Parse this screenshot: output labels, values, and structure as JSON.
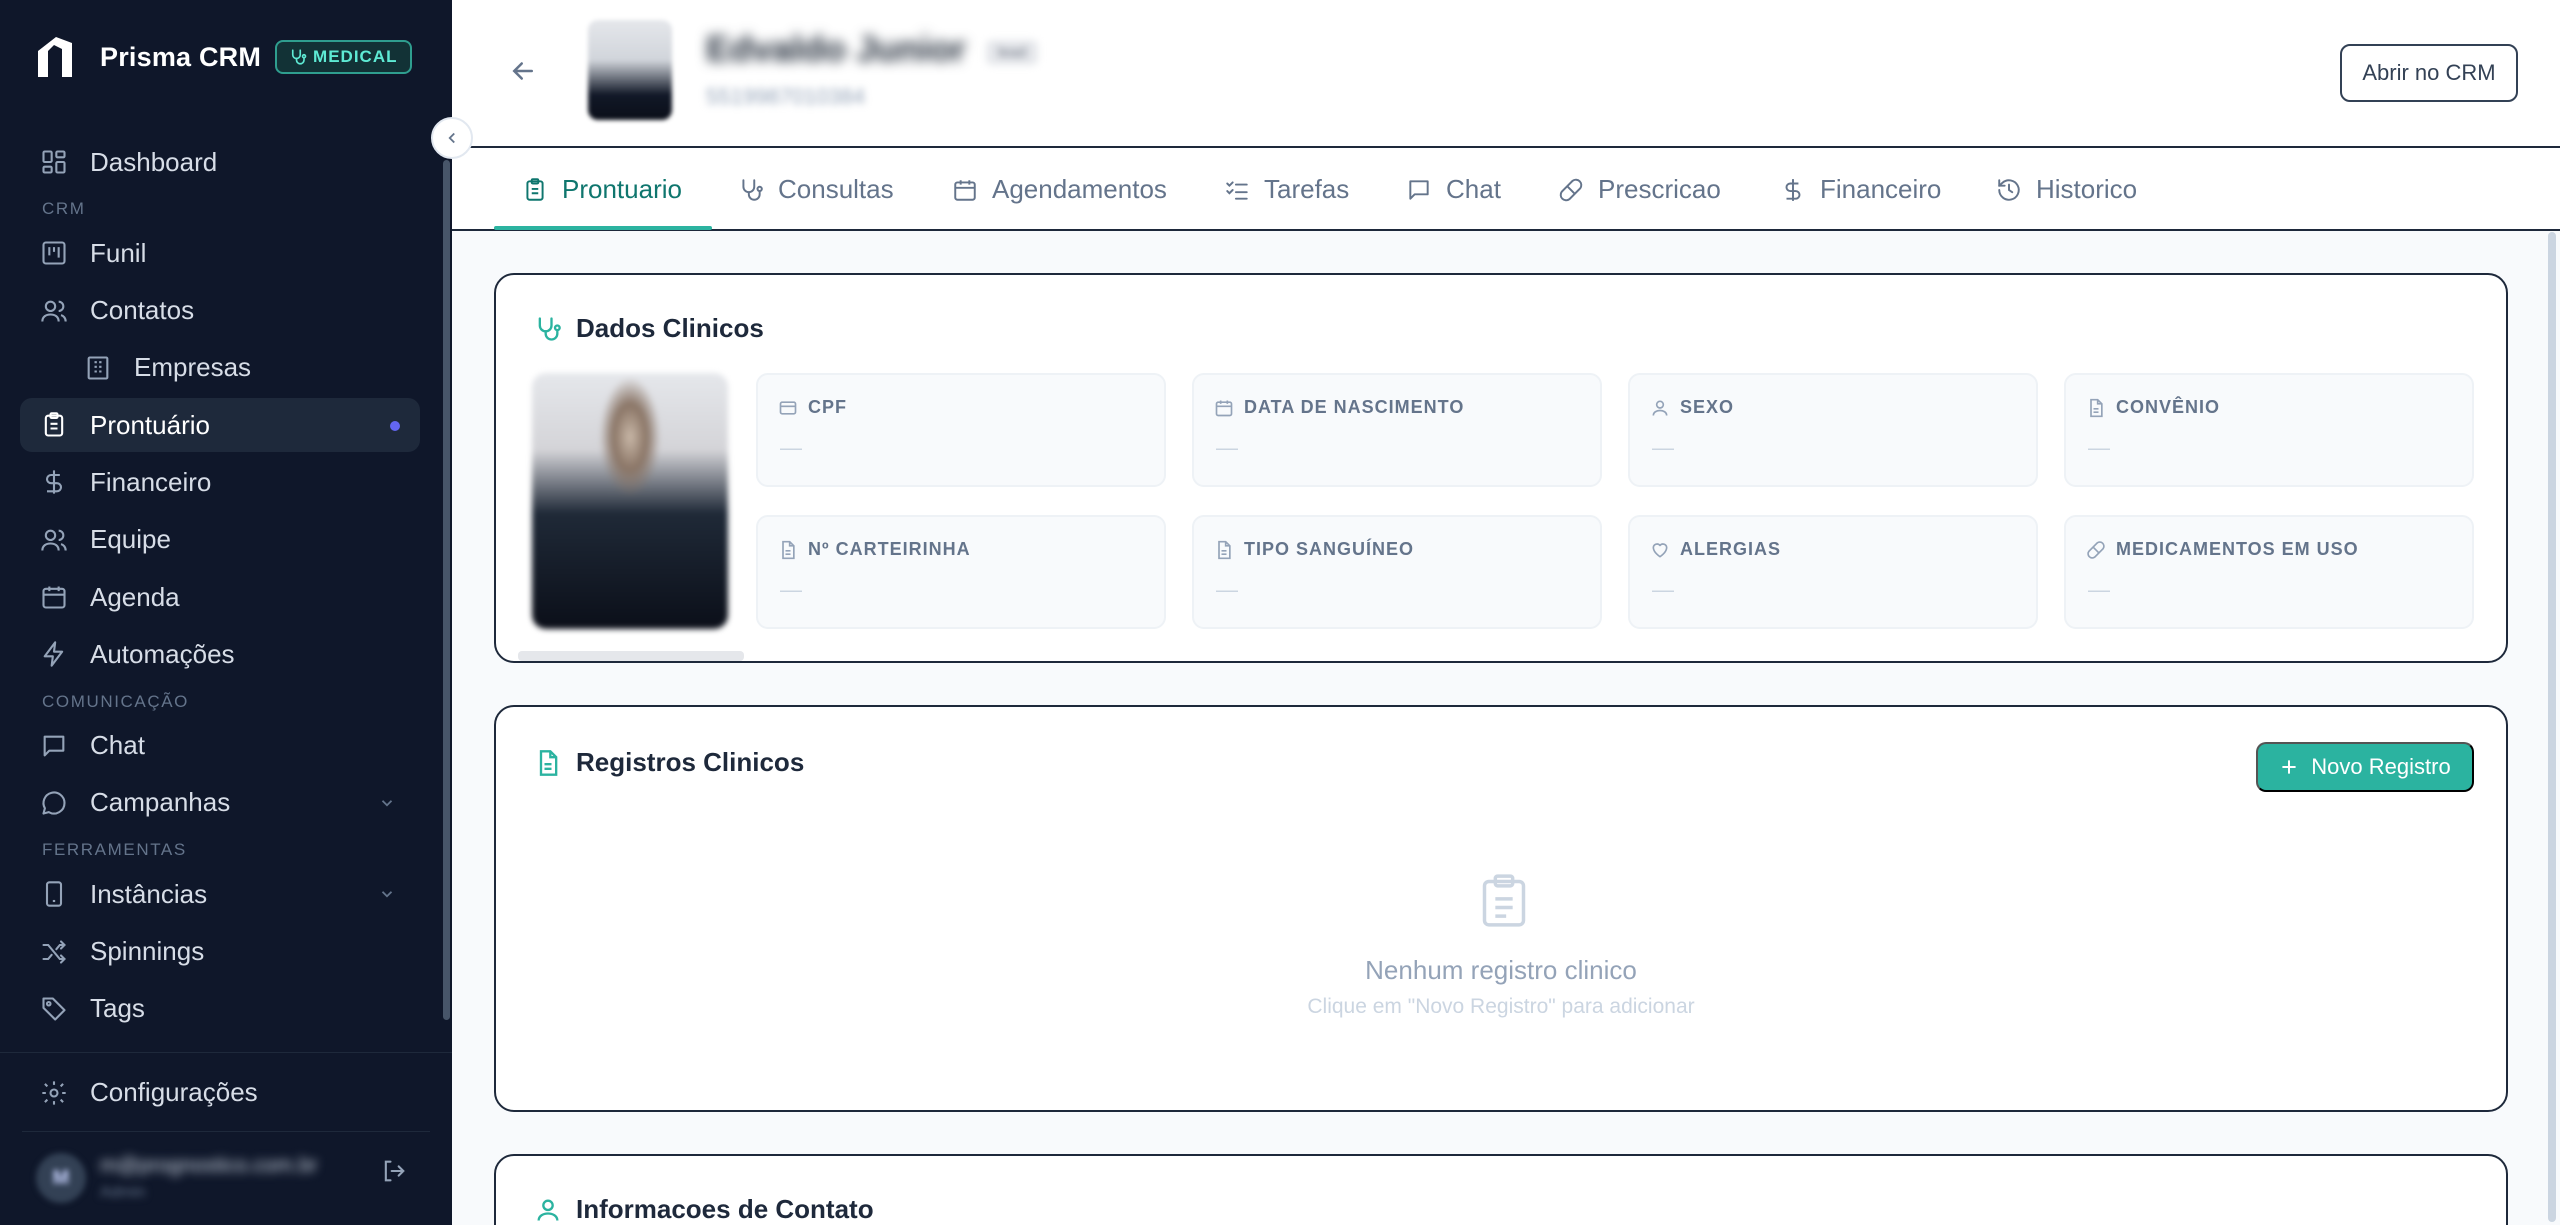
{
  "brand": {
    "name": "Prisma CRM",
    "badge": "MEDICAL"
  },
  "sidebar": {
    "dashboard": "Dashboard",
    "section_crm": "CRM",
    "funil": "Funil",
    "contatos": "Contatos",
    "empresas": "Empresas",
    "prontuario": "Prontuário",
    "financeiro": "Financeiro",
    "equipe": "Equipe",
    "agenda": "Agenda",
    "automacoes": "Automações",
    "section_comunicacao": "COMUNICAÇÃO",
    "chat": "Chat",
    "campanhas": "Campanhas",
    "section_ferramentas": "FERRAMENTAS",
    "instancias": "Instâncias",
    "spinnings": "Spinnings",
    "tags": "Tags",
    "configuracoes": "Configurações"
  },
  "user": {
    "initials": "M",
    "name": "m@prognostico.com.br",
    "role": "Admin"
  },
  "header": {
    "patient_name": "Edvaldo Junior",
    "patient_tag": "lead",
    "patient_phone": "5519987010384",
    "open_crm": "Abrir no CRM"
  },
  "tabs": [
    "Prontuario",
    "Consultas",
    "Agendamentos",
    "Tarefas",
    "Chat",
    "Prescricao",
    "Financeiro",
    "Historico"
  ],
  "clinical": {
    "title": "Dados Clinicos",
    "fields": [
      {
        "label": "CPF",
        "value": "—"
      },
      {
        "label": "DATA DE NASCIMENTO",
        "value": "—"
      },
      {
        "label": "SEXO",
        "value": "—"
      },
      {
        "label": "CONVÊNIO",
        "value": "—"
      },
      {
        "label": "Nº CARTEIRINHA",
        "value": "—"
      },
      {
        "label": "TIPO SANGUÍNEO",
        "value": "—"
      },
      {
        "label": "ALERGIAS",
        "value": "—"
      },
      {
        "label": "MEDICAMENTOS EM USO",
        "value": "—"
      }
    ]
  },
  "records": {
    "title": "Registros Clinicos",
    "new_button": "Novo Registro",
    "empty_title": "Nenhum registro clinico",
    "empty_subtitle": "Clique em \"Novo Registro\" para adicionar"
  },
  "contact": {
    "title": "Informacoes de Contato"
  },
  "colors": {
    "sidebar": "#0f172a",
    "accent": "#2bb3a0",
    "active_dot": "#6366f1"
  }
}
